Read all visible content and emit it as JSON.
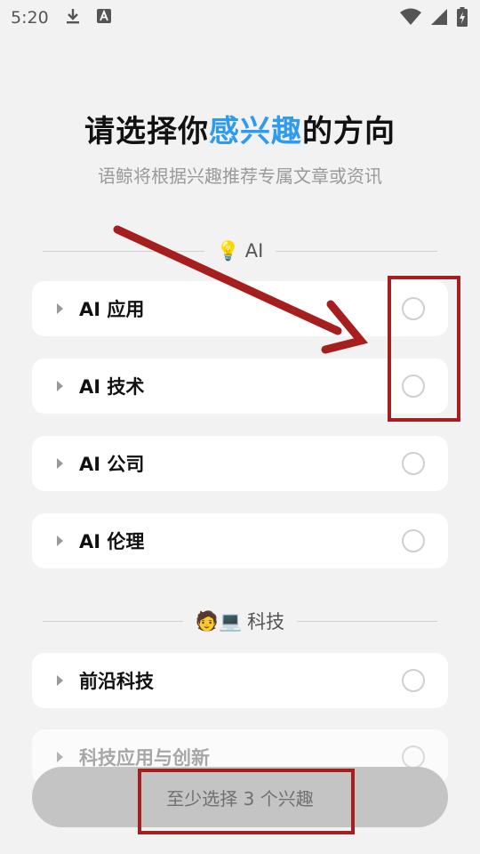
{
  "status_bar": {
    "time": "5:20",
    "left_icons": [
      "download-icon",
      "a-notification-icon"
    ],
    "right_icons": [
      "wifi-icon",
      "signal-icon",
      "battery-charging-icon"
    ]
  },
  "header": {
    "title_prefix": "请选择你",
    "title_highlight": "感兴趣",
    "title_suffix": "的方向",
    "subtitle": "语鲸将根据兴趣推荐专属文章或资讯"
  },
  "sections": [
    {
      "emoji": "💡",
      "label": "AI",
      "items": [
        {
          "label": "AI 应用",
          "selected": false
        },
        {
          "label": "AI 技术",
          "selected": false
        },
        {
          "label": "AI 公司",
          "selected": false
        },
        {
          "label": "AI 伦理",
          "selected": false
        }
      ]
    },
    {
      "emoji": "🧑💻",
      "label": "科技",
      "items": [
        {
          "label": "前沿科技",
          "selected": false
        },
        {
          "label": "科技应用与创新",
          "selected": false
        }
      ]
    }
  ],
  "bottom_button": {
    "label": "至少选择 3 个兴趣"
  },
  "colors": {
    "accent": "#2e9bf0",
    "annotation": "#a61e1e",
    "background": "#f2f2f2",
    "button_disabled": "#c4c4c4"
  }
}
